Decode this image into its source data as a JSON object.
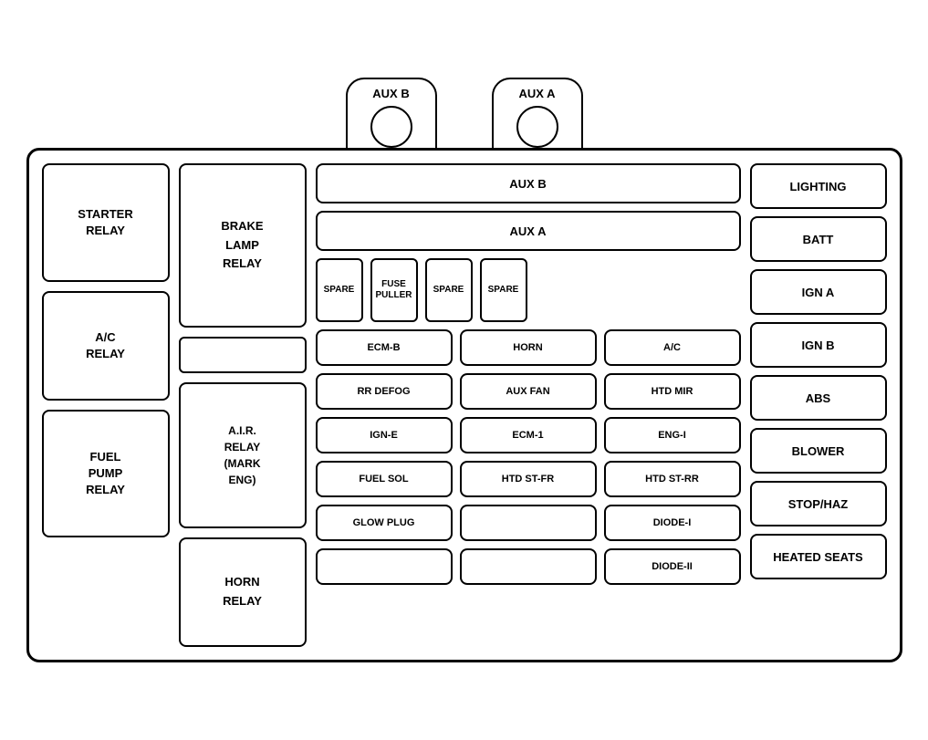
{
  "connectors": [
    {
      "label": "AUX B",
      "id": "aux-b-connector"
    },
    {
      "label": "AUX A",
      "id": "aux-a-connector"
    }
  ],
  "left_relays": [
    {
      "id": "starter-relay",
      "label": "STARTER\nRELAY"
    },
    {
      "id": "ac-relay",
      "label": "A/C\nRELAY"
    },
    {
      "id": "fuel-pump-relay",
      "label": "FUEL\nPUMP\nRELAY"
    }
  ],
  "second_relays": [
    {
      "id": "brake-lamp-relay",
      "label": "BRAKE\nLAMP\nRELAY"
    },
    {
      "id": "air-relay",
      "label": "A.I.R.\nRELAY\n(MARK\nENG)"
    },
    {
      "id": "horn-relay",
      "label": "HORN\nRELAY"
    }
  ],
  "middle_top": [
    {
      "id": "aux-b-fuse",
      "label": "AUX B"
    },
    {
      "id": "aux-a-fuse",
      "label": "AUX A"
    }
  ],
  "spare_row": [
    {
      "id": "spare-1",
      "label": "SPARE"
    },
    {
      "id": "fuse-puller",
      "label": "FUSE\nPULLER"
    },
    {
      "id": "spare-2",
      "label": "SPARE"
    },
    {
      "id": "spare-3",
      "label": "SPARE"
    }
  ],
  "row1": [
    {
      "id": "ecm-b",
      "label": "ECM-B"
    },
    {
      "id": "horn",
      "label": "HORN"
    },
    {
      "id": "ac",
      "label": "A/C"
    }
  ],
  "row2": [
    {
      "id": "rr-defog",
      "label": "RR DEFOG"
    },
    {
      "id": "aux-fan",
      "label": "AUX FAN"
    },
    {
      "id": "htd-mir",
      "label": "HTD MIR"
    }
  ],
  "row3": [
    {
      "id": "ign-e",
      "label": "IGN-E"
    },
    {
      "id": "ecm-1",
      "label": "ECM-1"
    },
    {
      "id": "eng-i",
      "label": "ENG-I"
    }
  ],
  "row4": [
    {
      "id": "fuel-sol",
      "label": "FUEL SOL"
    },
    {
      "id": "htd-st-fr",
      "label": "HTD ST-FR"
    },
    {
      "id": "htd-st-rr",
      "label": "HTD ST-RR"
    }
  ],
  "row5": [
    {
      "id": "glow-plug",
      "label": "GLOW PLUG"
    },
    {
      "id": "blank-1",
      "label": ""
    },
    {
      "id": "diode-i",
      "label": "DIODE-I"
    }
  ],
  "row6": [
    {
      "id": "blank-2",
      "label": ""
    },
    {
      "id": "blank-3",
      "label": ""
    },
    {
      "id": "diode-ii",
      "label": "DIODE-II"
    }
  ],
  "right_fuses": [
    {
      "id": "lighting",
      "label": "LIGHTING"
    },
    {
      "id": "batt",
      "label": "BATT"
    },
    {
      "id": "ign-a",
      "label": "IGN A"
    },
    {
      "id": "ign-b",
      "label": "IGN B"
    },
    {
      "id": "abs",
      "label": "ABS"
    },
    {
      "id": "blower",
      "label": "BLOWER"
    },
    {
      "id": "stop-haz",
      "label": "STOP/HAZ"
    },
    {
      "id": "heated-seats",
      "label": "HEATED SEATS"
    }
  ],
  "second_col_small": [
    {
      "id": "small-blank-top",
      "label": ""
    }
  ]
}
